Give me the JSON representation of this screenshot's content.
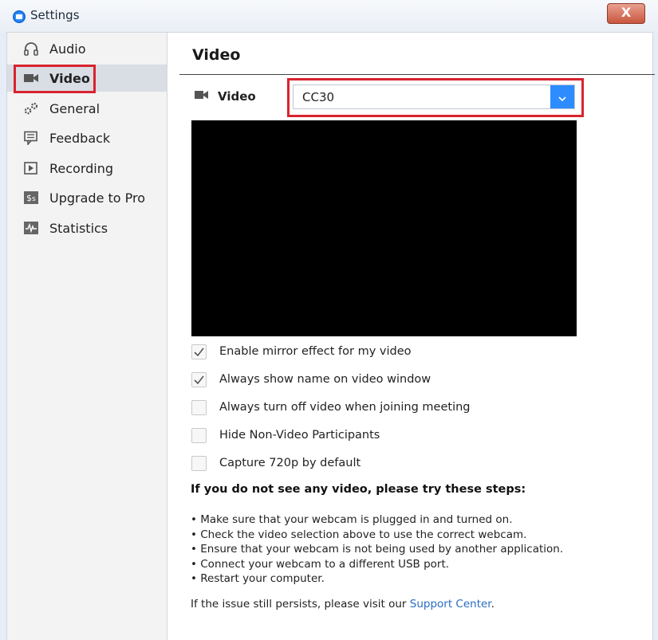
{
  "window": {
    "title": "Settings",
    "close_label": "X"
  },
  "sidebar": {
    "items": [
      {
        "label": "Audio",
        "icon": "headphones-icon"
      },
      {
        "label": "Video",
        "icon": "video-camera-icon",
        "active": true
      },
      {
        "label": "General",
        "icon": "gears-icon"
      },
      {
        "label": "Feedback",
        "icon": "feedback-icon"
      },
      {
        "label": "Recording",
        "icon": "recording-icon"
      },
      {
        "label": "Upgrade to Pro",
        "icon": "upgrade-dollar-icon"
      },
      {
        "label": "Statistics",
        "icon": "statistics-icon"
      }
    ]
  },
  "main": {
    "title": "Video",
    "camera_label": "Video",
    "camera_value": "CC30",
    "options": [
      {
        "label": "Enable mirror effect for my video",
        "checked": true
      },
      {
        "label": "Always show name on video window",
        "checked": true
      },
      {
        "label": "Always turn off video when joining meeting",
        "checked": false
      },
      {
        "label": "Hide Non-Video Participants",
        "checked": false
      },
      {
        "label": "Capture 720p by default",
        "checked": false
      }
    ],
    "help_title": "If you do not see any video, please try these steps:",
    "steps": [
      "• Make sure that your webcam is plugged in and turned on.",
      "• Check the video selection above to use the correct webcam.",
      "• Ensure that your webcam is not being used by another application.",
      "• Connect your webcam to a different USB port.",
      "• Restart your computer."
    ],
    "footer_prefix": "If the issue still persists, please visit our ",
    "footer_link": "Support Center",
    "footer_suffix": "."
  },
  "colors": {
    "accent": "#2d8cff",
    "highlight": "#d9232f",
    "sidebar_bg": "#f3f3f3",
    "active_bg": "#d9dde4"
  }
}
